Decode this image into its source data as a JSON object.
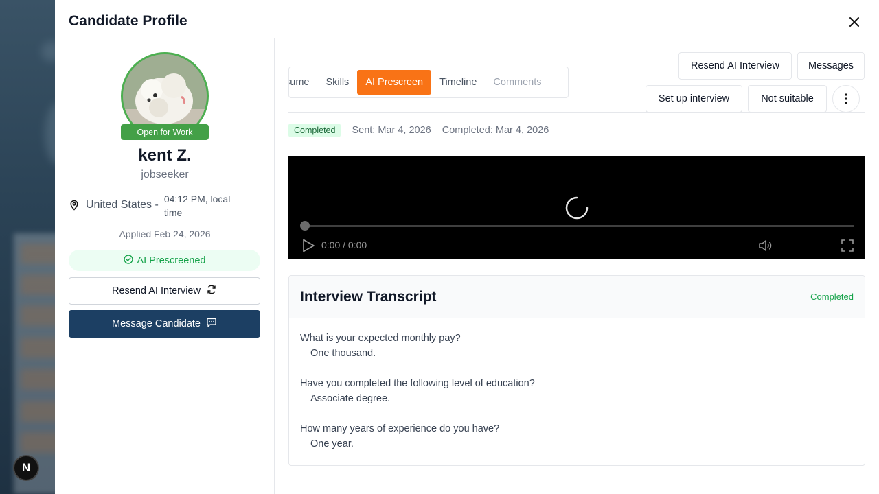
{
  "modal": {
    "title": "Candidate Profile"
  },
  "profile": {
    "status_badge": "Open for Work",
    "name": "kent Z.",
    "role": "jobseeker",
    "location_country": "United States -",
    "local_time": "04:12 PM, local time",
    "applied": "Applied Feb 24, 2026",
    "ai_status": "AI Prescreened",
    "resend_button": "Resend AI Interview",
    "message_button": "Message Candidate"
  },
  "tabs": [
    {
      "label": "sume",
      "state": "normal"
    },
    {
      "label": "Skills",
      "state": "normal"
    },
    {
      "label": "AI Prescreen",
      "state": "active"
    },
    {
      "label": "Timeline",
      "state": "normal"
    },
    {
      "label": "Comments",
      "state": "disabled"
    }
  ],
  "actions": {
    "resend_ai": "Resend AI Interview",
    "messages": "Messages",
    "setup_interview": "Set up interview",
    "not_suitable": "Not suitable"
  },
  "prescreen": {
    "status": "Completed",
    "sent": "Sent: Mar 4, 2026",
    "completed": "Completed: Mar 4, 2026"
  },
  "video": {
    "time": "0:00 / 0:00",
    "progress": 0
  },
  "transcript": {
    "title": "Interview Transcript",
    "status": "Completed",
    "items": [
      {
        "question": "What is your expected monthly pay?",
        "answer": "One thousand."
      },
      {
        "question": "Have you completed the following level of education?",
        "answer": "Associate degree."
      },
      {
        "question": "How many years of experience do you have?",
        "answer": "One year."
      }
    ]
  },
  "colors": {
    "accent": "#f97316",
    "primary": "#1c3f63",
    "success": "#16a34a",
    "avatar_border": "#4caf50"
  },
  "background": {
    "badge": "N"
  }
}
